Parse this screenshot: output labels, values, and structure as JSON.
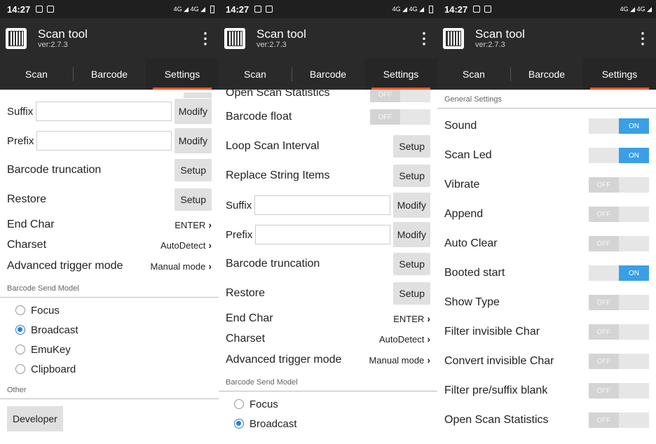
{
  "status": {
    "time": "14:27",
    "net": "4G ◢ 4G ◢"
  },
  "app": {
    "title": "Scan tool",
    "version": "ver:2.7.3"
  },
  "tabs": [
    "Scan",
    "Barcode",
    "Settings"
  ],
  "p1": {
    "suffix_label": "Suffix",
    "prefix_label": "Prefix",
    "modify": "Modify",
    "setup": "Setup",
    "truncation": "Barcode truncation",
    "restore": "Restore",
    "end_char": "End Char",
    "end_char_val": "ENTER",
    "charset": "Charset",
    "charset_val": "AutoDetect",
    "trigger": "Advanced trigger mode",
    "trigger_val": "Manual mode",
    "send_model": "Barcode Send Model",
    "radios": [
      "Focus",
      "Broadcast",
      "EmuKey",
      "Clipboard"
    ],
    "other": "Other",
    "developer": "Developer"
  },
  "p2": {
    "open_stats": "Open Scan Statistics",
    "float": "Barcode float",
    "loop": "Loop Scan Interval",
    "replace": "Replace String Items",
    "off": "OFF"
  },
  "p3": {
    "general": "General Settings",
    "on": "ON",
    "off": "OFF",
    "items": [
      {
        "label": "Sound",
        "on": true
      },
      {
        "label": "Scan Led",
        "on": true
      },
      {
        "label": "Vibrate",
        "on": false
      },
      {
        "label": "Append",
        "on": false
      },
      {
        "label": "Auto Clear",
        "on": false
      },
      {
        "label": "Booted start",
        "on": true
      },
      {
        "label": "Show Type",
        "on": false
      },
      {
        "label": "Filter invisible Char",
        "on": false
      },
      {
        "label": "Convert invisible Char",
        "on": false
      },
      {
        "label": "Filter pre/suffix blank",
        "on": false
      },
      {
        "label": "Open Scan Statistics",
        "on": false
      }
    ]
  }
}
